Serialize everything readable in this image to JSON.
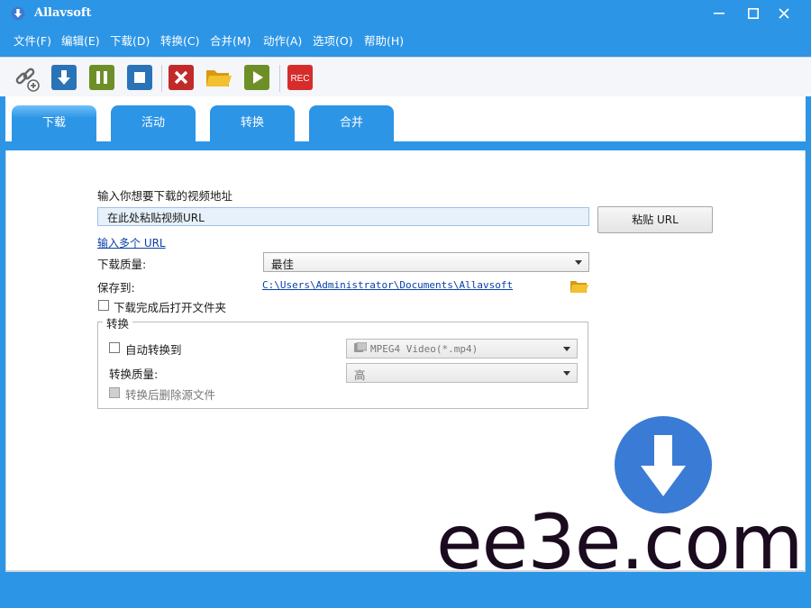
{
  "window": {
    "title": "Allavsoft"
  },
  "menu": [
    {
      "label": "文件(F)"
    },
    {
      "label": "编辑(E)"
    },
    {
      "label": "下载(D)"
    },
    {
      "label": "转换(C)"
    },
    {
      "label": "合并(M)"
    },
    {
      "label": "动作(A)"
    },
    {
      "label": "选项(O)"
    },
    {
      "label": "帮助(H)"
    }
  ],
  "toolbar": {
    "rec_label": "REC",
    "icons": [
      "link-add-icon",
      "download-icon",
      "pause-icon",
      "stop-icon",
      "cancel-icon",
      "folder-icon",
      "play-icon",
      "rec-icon"
    ]
  },
  "tabs": [
    {
      "label": "下载",
      "active": true
    },
    {
      "label": "活动",
      "active": false
    },
    {
      "label": "转换",
      "active": false
    },
    {
      "label": "合并",
      "active": false
    }
  ],
  "download": {
    "prompt": "输入你想要下载的视频地址",
    "url_value": "在此处粘贴视频URL",
    "paste_button": "粘贴 URL",
    "multi_url_link": "输入多个 URL",
    "quality_label": "下载质量:",
    "quality_value": "最佳",
    "save_to_label": "保存到:",
    "save_path": "C:\\Users\\Administrator\\Documents\\Allavsoft",
    "open_folder_label": "下载完成后打开文件夹",
    "open_folder_checked": false
  },
  "convert_group": {
    "title": "转换",
    "auto_convert_label": "自动转换到",
    "auto_convert_checked": false,
    "format_value": "MPEG4 Video(*.mp4)",
    "quality_label": "转换质量:",
    "quality_value": "高",
    "delete_source_label": "转换后删除源文件",
    "delete_source_checked": false
  },
  "watermark": {
    "text": "ee3e.com"
  },
  "colors": {
    "accent": "#2d95e6",
    "link": "#0a3fa8",
    "watermark_circle": "#3a7bd5",
    "watermark_text": "#1b0b1f"
  }
}
